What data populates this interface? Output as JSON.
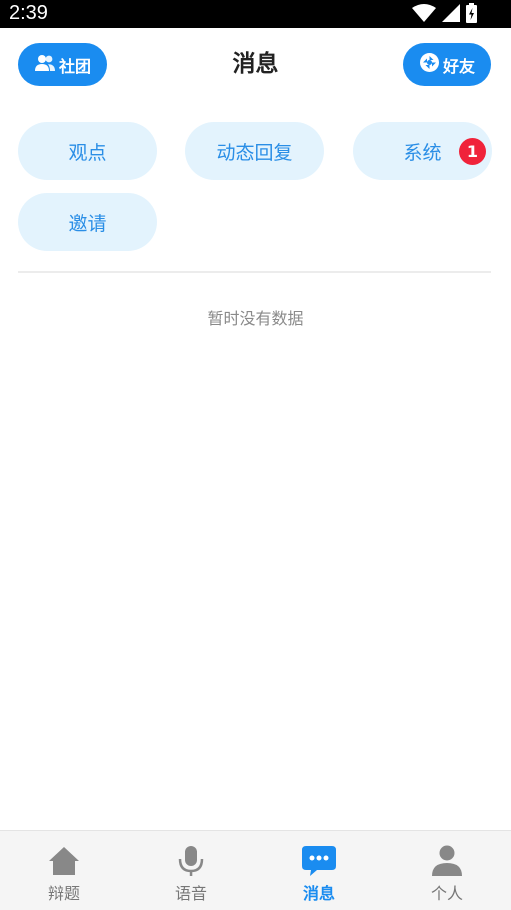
{
  "status_bar": {
    "time": "2:39"
  },
  "header": {
    "left_button_label": "社团",
    "title": "消息",
    "right_button_label": "好友"
  },
  "categories": [
    {
      "label": "观点"
    },
    {
      "label": "动态回复"
    },
    {
      "label": "系统",
      "badge": "1"
    },
    {
      "label": "邀请"
    }
  ],
  "empty_state": {
    "text": "暂时没有数据"
  },
  "bottom_nav": {
    "items": [
      {
        "label": "辩题",
        "icon": "home-icon"
      },
      {
        "label": "语音",
        "icon": "microphone-icon"
      },
      {
        "label": "消息",
        "icon": "chat-bubble-icon",
        "active": true
      },
      {
        "label": "个人",
        "icon": "person-icon"
      }
    ]
  },
  "colors": {
    "accent": "#1a8cf0",
    "chip_background": "#e3f3fd",
    "chip_text": "#2a8ee6",
    "badge": "#f0233a",
    "nav_inactive": "#8a8a8a"
  }
}
